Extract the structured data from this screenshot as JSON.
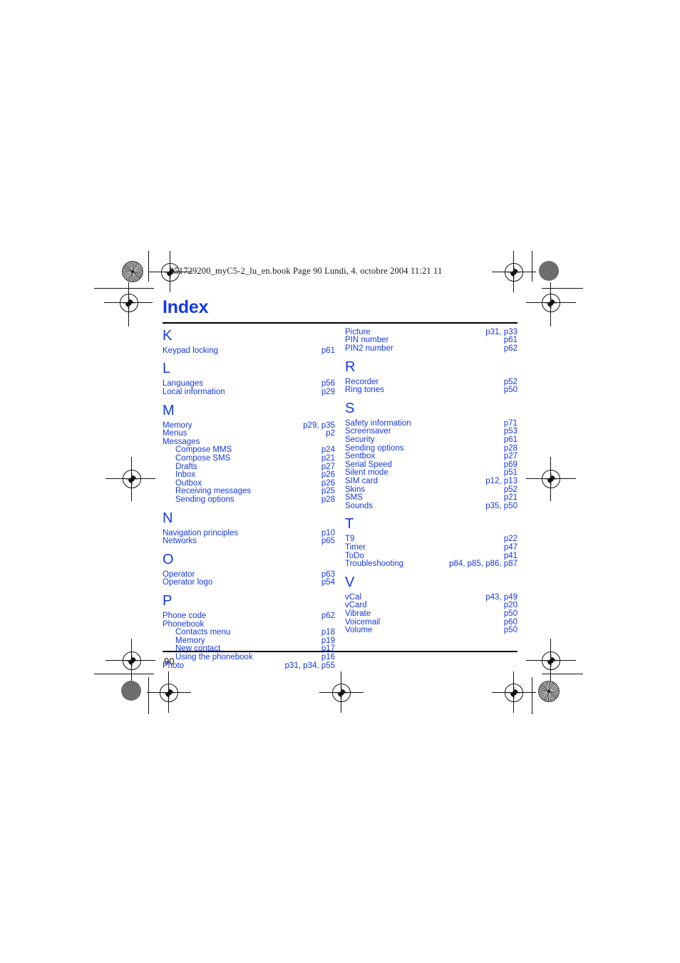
{
  "document": {
    "header_line": "251729200_myC5-2_lu_en.book  Page 90  Lundi, 4. octobre 2004  11:21 11",
    "title": "Index",
    "folio": "90",
    "accent_color": "#1538e6",
    "rule_color": "#000000"
  },
  "columns": [
    {
      "sections": [
        {
          "letter": "K",
          "entries": [
            {
              "label": "Keypad locking",
              "pages": "p61",
              "indent": false
            }
          ]
        },
        {
          "letter": "L",
          "entries": [
            {
              "label": "Languages",
              "pages": "p56",
              "indent": false
            },
            {
              "label": "Local information",
              "pages": "p29",
              "indent": false
            }
          ]
        },
        {
          "letter": "M",
          "entries": [
            {
              "label": "Memory",
              "pages": "p29, p35",
              "indent": false
            },
            {
              "label": "Menus",
              "pages": "p2",
              "indent": false
            },
            {
              "label": "Messages",
              "pages": "",
              "indent": false
            },
            {
              "label": "Compose MMS",
              "pages": "p24",
              "indent": true
            },
            {
              "label": "Compose SMS",
              "pages": "p21",
              "indent": true
            },
            {
              "label": "Drafts",
              "pages": "p27",
              "indent": true
            },
            {
              "label": "Inbox",
              "pages": "p26",
              "indent": true
            },
            {
              "label": "Outbox",
              "pages": "p26",
              "indent": true
            },
            {
              "label": "Receiving messages",
              "pages": "p25",
              "indent": true
            },
            {
              "label": "Sending options",
              "pages": "p28",
              "indent": true
            }
          ]
        },
        {
          "letter": "N",
          "entries": [
            {
              "label": "Navigation principles",
              "pages": "p10",
              "indent": false
            },
            {
              "label": "Networks",
              "pages": "p65",
              "indent": false
            }
          ]
        },
        {
          "letter": "O",
          "entries": [
            {
              "label": "Operator",
              "pages": "p63",
              "indent": false
            },
            {
              "label": "Operator logo",
              "pages": "p54",
              "indent": false
            }
          ]
        },
        {
          "letter": "P",
          "entries": [
            {
              "label": "Phone code",
              "pages": "p62",
              "indent": false
            },
            {
              "label": "Phonebook",
              "pages": "",
              "indent": false
            },
            {
              "label": "Contacts menu",
              "pages": "p18",
              "indent": true
            },
            {
              "label": "Memory",
              "pages": "p19",
              "indent": true
            },
            {
              "label": "New contact",
              "pages": "p17",
              "indent": true
            },
            {
              "label": "Using the phonebook",
              "pages": "p16",
              "indent": true
            },
            {
              "label": "Photo",
              "pages": "p31, p34, p55",
              "indent": false
            }
          ]
        }
      ]
    },
    {
      "sections": [
        {
          "letter": "",
          "entries": [
            {
              "label": "Picture",
              "pages": "p31, p33",
              "indent": false
            },
            {
              "label": "PIN number",
              "pages": "p61",
              "indent": false
            },
            {
              "label": "PIN2 number",
              "pages": "p62",
              "indent": false
            }
          ]
        },
        {
          "letter": "R",
          "entries": [
            {
              "label": "Recorder",
              "pages": "p52",
              "indent": false
            },
            {
              "label": "Ring tones",
              "pages": "p50",
              "indent": false
            }
          ]
        },
        {
          "letter": "S",
          "entries": [
            {
              "label": "Safety information",
              "pages": "p71",
              "indent": false
            },
            {
              "label": "Screensaver",
              "pages": "p53",
              "indent": false
            },
            {
              "label": "Security",
              "pages": "p61",
              "indent": false
            },
            {
              "label": "Sending options",
              "pages": "p28",
              "indent": false
            },
            {
              "label": "Sentbox",
              "pages": "p27",
              "indent": false
            },
            {
              "label": "Serial Speed",
              "pages": "p69",
              "indent": false
            },
            {
              "label": "Silent mode",
              "pages": "p51",
              "indent": false
            },
            {
              "label": "SIM card",
              "pages": "p12, p13",
              "indent": false
            },
            {
              "label": "Skins",
              "pages": "p52",
              "indent": false
            },
            {
              "label": "SMS",
              "pages": "p21",
              "indent": false
            },
            {
              "label": "Sounds",
              "pages": "p35, p50",
              "indent": false
            }
          ]
        },
        {
          "letter": "T",
          "entries": [
            {
              "label": "T9",
              "pages": "p22",
              "indent": false
            },
            {
              "label": "Timer",
              "pages": "p47",
              "indent": false
            },
            {
              "label": "ToDo",
              "pages": "p41",
              "indent": false
            },
            {
              "label": "Troubleshooting",
              "pages": "p84, p85, p86, p87",
              "indent": false
            }
          ]
        },
        {
          "letter": "V",
          "entries": [
            {
              "label": "vCal",
              "pages": "p43, p49",
              "indent": false
            },
            {
              "label": "vCard",
              "pages": "p20",
              "indent": false
            },
            {
              "label": "Vibrate",
              "pages": "p50",
              "indent": false
            },
            {
              "label": "Voicemail",
              "pages": "p60",
              "indent": false
            },
            {
              "label": "Volume",
              "pages": "p50",
              "indent": false
            }
          ]
        }
      ]
    }
  ]
}
